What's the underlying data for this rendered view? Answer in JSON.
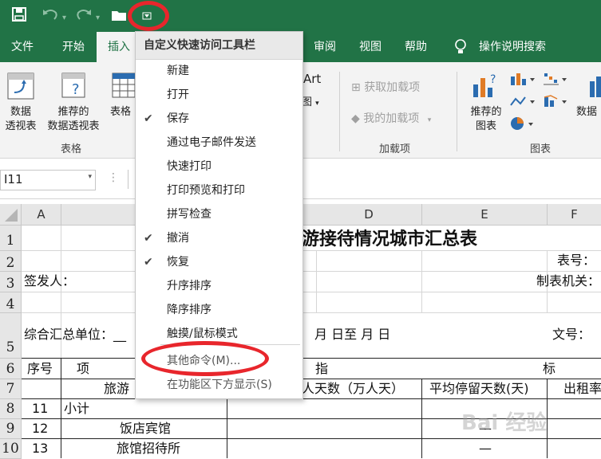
{
  "accent_color": "#217346",
  "highlight_color": "#e8262c",
  "quick_access": {
    "icons": [
      "save-icon",
      "undo-icon",
      "redo-icon",
      "folder-icon",
      "customize-dropdown-icon"
    ]
  },
  "ribbon_tabs": {
    "file": "文件",
    "home": "开始",
    "insert": "插入",
    "review": "审阅",
    "view": "视图",
    "help": "帮助",
    "tell_me": "操作说明搜索"
  },
  "ribbon": {
    "pivot_table": [
      "数据",
      "透视表"
    ],
    "recommended_pivot": [
      "推荐的",
      "数据透视表"
    ],
    "table": "表格",
    "group_tables": "表格",
    "smartart_partial": "Art",
    "screenshot_partial": "图",
    "get_addins": "获取加载项",
    "my_addins": "我的加载项",
    "group_addins": "加载项",
    "recommended_charts": [
      "推荐的",
      "图表"
    ],
    "pivot_chart_partial": "数据",
    "group_charts": "图表"
  },
  "name_box": "I11",
  "columns": [
    "A",
    "D",
    "E",
    "F"
  ],
  "rows": [
    "1",
    "2",
    "3",
    "4",
    "5",
    "6",
    "7",
    "8",
    "9",
    "10"
  ],
  "cells": {
    "title": "游接待情况城市汇总表",
    "table_no": "表号：",
    "issuer": "签发人：",
    "maker": "制表机关：",
    "unit": "综合汇总单位：__",
    "date": "月  日至  月  日",
    "doc_no": "文号：",
    "seq": "序号",
    "item": "项",
    "zhi": "指",
    "biao": "标",
    "travel": "旅游",
    "person_days": "人天数（万人天）",
    "avg_stay": "平均停留天数(天)",
    "rent_rate": "出租率",
    "r8_num": "11",
    "r8_label": "小计",
    "r9_num": "12",
    "r9_label": "饭店宾馆",
    "r9_dash": "—",
    "r10_num": "13",
    "r10_label": "旅馆招待所",
    "r10_dash": "—"
  },
  "menu": {
    "title": "自定义快速访问工具栏",
    "items": [
      {
        "label": "新建",
        "checked": false
      },
      {
        "label": "打开",
        "checked": false
      },
      {
        "label": "保存",
        "checked": true
      },
      {
        "label": "通过电子邮件发送",
        "checked": false
      },
      {
        "label": "快速打印",
        "checked": false
      },
      {
        "label": "打印预览和打印",
        "checked": false
      },
      {
        "label": "拼写检查",
        "checked": false
      },
      {
        "label": "撤消",
        "checked": true
      },
      {
        "label": "恢复",
        "checked": true
      },
      {
        "label": "升序排序",
        "checked": false
      },
      {
        "label": "降序排序",
        "checked": false
      },
      {
        "label": "触摸/鼠标模式",
        "checked": false
      }
    ],
    "more_commands": "其他命令(M)...",
    "show_below": "在功能区下方显示(S)",
    "check_mark": "✔"
  },
  "watermark": "Bai 经验"
}
